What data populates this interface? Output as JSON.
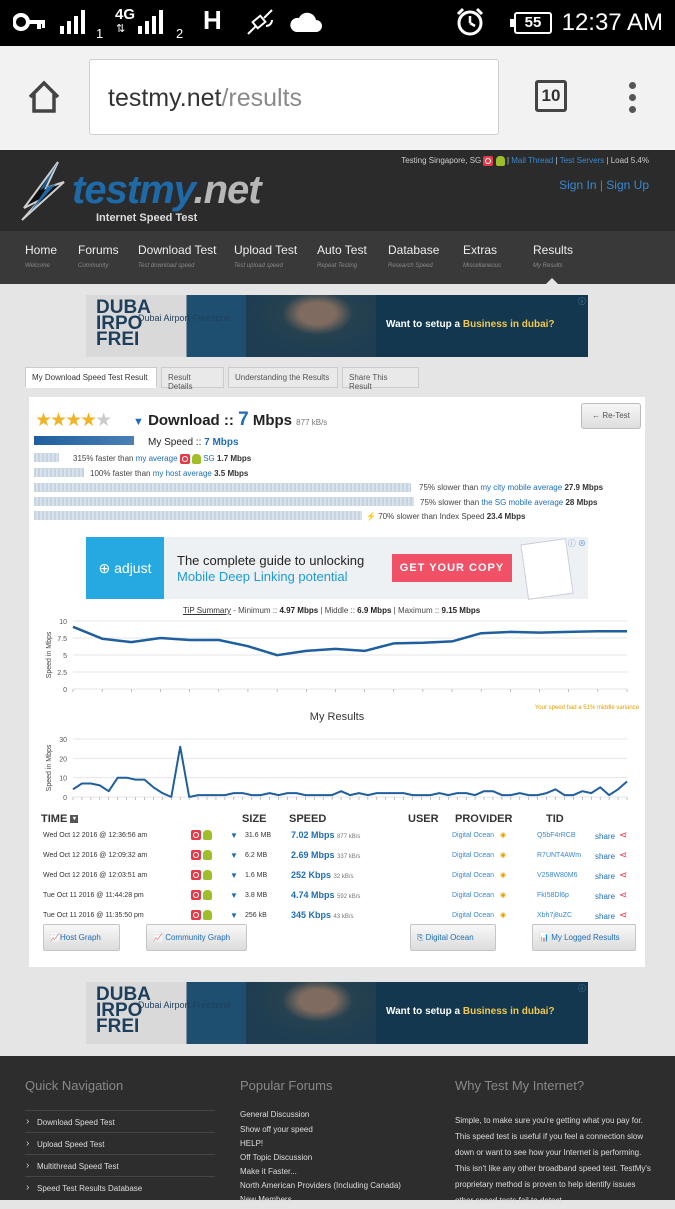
{
  "status_bar": {
    "sim1": "1",
    "net": "4G",
    "sim2": "2",
    "battery": "55",
    "time": "12:37 AM"
  },
  "browser": {
    "url_host": "testmy.net",
    "url_path": "/results",
    "tab_count": "10"
  },
  "site": {
    "logo_main": "testmy",
    "logo_tld": ".net",
    "logo_sub": "Internet Speed Test",
    "top_info_prefix": "Testing Singapore, SG",
    "top_info_links": [
      "Mail Thread",
      "Test Servers"
    ],
    "top_info_load": "Load 5.4%",
    "sign_in": "Sign In",
    "sign_up": "Sign Up"
  },
  "nav": [
    {
      "label": "Home",
      "sub": "Welcome"
    },
    {
      "label": "Forums",
      "sub": "Community"
    },
    {
      "label": "Download Test",
      "sub": "Test download speed"
    },
    {
      "label": "Upload Test",
      "sub": "Test upload speed"
    },
    {
      "label": "Auto Test",
      "sub": "Repeat Testing"
    },
    {
      "label": "Database",
      "sub": "Research Speed"
    },
    {
      "label": "Extras",
      "sub": "Miscellaneous"
    },
    {
      "label": "Results",
      "sub": "My Results"
    }
  ],
  "ad_top": {
    "brand_lines": "DUBA IRPO FREI",
    "brand_name": "Dubai Airport Freezone",
    "msg_pre": "Want to setup a",
    "msg_hl": "Business in dubai?",
    "close": "ⓘ"
  },
  "subtabs": [
    "My Download Speed Test Result",
    "Result Details",
    "Understanding the Results",
    "Share This Result"
  ],
  "result": {
    "rating": 4,
    "title": "Download",
    "sep": "::",
    "value": "7",
    "unit": "Mbps",
    "kb": "877 kB/s",
    "retest": "← Re-Test",
    "my_speed_label": "My Speed ::",
    "my_speed_value": "7 Mbps",
    "comparisons_left": [
      {
        "pre": "315% faster than",
        "link": "my average",
        "after": "SG",
        "value": "1.7 Mbps",
        "fraction": 0.245
      },
      {
        "pre": "100% faster than",
        "link": "my host average",
        "after": "",
        "value": "3.5 Mbps",
        "fraction": 0.125
      }
    ],
    "comparisons_right": [
      {
        "pre": "75% slower than",
        "link": "my city mobile average",
        "value": "27.9 Mbps",
        "fraction": 0.995
      },
      {
        "pre": "75% slower than",
        "link": "the SG mobile average",
        "value": "28 Mbps",
        "fraction": 0.999
      },
      {
        "pre": "70% slower than Index Speed",
        "link": "",
        "value": "23.4 Mbps",
        "fraction": 0.835
      }
    ]
  },
  "ad_mid": {
    "brand": "adjust",
    "line1": "The complete guide to unlocking",
    "line2": "Mobile Deep Linking potential",
    "cta": "GET YOUR COPY"
  },
  "tip": {
    "label": "TiP Summary",
    "min_label": "Minimum ::",
    "min": "4.97 Mbps",
    "mid_label": "Middle ::",
    "mid": "6.9 Mbps",
    "max_label": "Maximum ::",
    "max": "9.15 Mbps",
    "variance": "Your speed had a 51% middle variance"
  },
  "chart_data": [
    {
      "type": "line",
      "title": "",
      "ylabel": "Speed in Mbps",
      "ylim": [
        0,
        10
      ],
      "yticks": [
        0,
        2.5,
        5,
        7.5,
        10
      ],
      "series": [
        {
          "values": [
            9.15,
            7.4,
            6.9,
            7.5,
            7.2,
            7.2,
            6.3,
            4.97,
            5.6,
            5.9,
            5.6,
            6.7,
            6.8,
            7.0,
            8.2,
            8.4,
            8.3,
            8.4,
            8.5,
            8.5
          ]
        }
      ]
    },
    {
      "type": "line",
      "title": "My Results",
      "ylabel": "Speed in Mbps",
      "ylim": [
        0,
        30
      ],
      "yticks": [
        0,
        10,
        20,
        30
      ],
      "series": [
        {
          "values": [
            4,
            7,
            7,
            6,
            3,
            10,
            10,
            9,
            9,
            5,
            2,
            0,
            26,
            0,
            1,
            1,
            1,
            1,
            2,
            2,
            1,
            1,
            2,
            1,
            2,
            2,
            1,
            1,
            1,
            1,
            3,
            1,
            2,
            1,
            2,
            2,
            2,
            2,
            1,
            1,
            1,
            2,
            1,
            2,
            2,
            1,
            3,
            3,
            1,
            1,
            2,
            1,
            1,
            2,
            4,
            1,
            1,
            3,
            2,
            5,
            1,
            4,
            8
          ]
        }
      ]
    }
  ],
  "table": {
    "headers": {
      "time": "TIME",
      "size": "SIZE",
      "speed": "SPEED",
      "user": "USER",
      "provider": "PROVIDER",
      "tid": "TID"
    },
    "rows": [
      {
        "time": "Wed Oct 12 2016 @ 12:36:56 am",
        "size": "31.6 MB",
        "speed": "7.02 Mbps",
        "kb": "877 kB/s",
        "provider": "Digital Ocean",
        "tid": "Q5bF4rRCB",
        "share": "share"
      },
      {
        "time": "Wed Oct 12 2016 @ 12:09:32 am",
        "size": "6.2 MB",
        "speed": "2.69 Mbps",
        "kb": "337 kB/s",
        "provider": "Digital Ocean",
        "tid": "R7UNT4AWm",
        "share": "share"
      },
      {
        "time": "Wed Oct 12 2016 @ 12:03:51 am",
        "size": "1.6 MB",
        "speed": "252 Kbps",
        "kb": "32 kB/s",
        "provider": "Digital Ocean",
        "tid": "V258W80M6",
        "share": "share"
      },
      {
        "time": "Tue Oct 11 2016 @ 11:44:28 pm",
        "size": "3.8 MB",
        "speed": "4.74 Mbps",
        "kb": "592 kB/s",
        "provider": "Digital Ocean",
        "tid": "FkI58Dl6p",
        "share": "share"
      },
      {
        "time": "Tue Oct 11 2016 @ 11:35:50 pm",
        "size": "256 kB",
        "speed": "345 Kbps",
        "kb": "43 kB/s",
        "provider": "Digital Ocean",
        "tid": "Xbh7j8uZC",
        "share": "share"
      }
    ]
  },
  "buttons": {
    "host_graph": "Host Graph",
    "community_graph": "Community Graph",
    "digital_ocean": "Digital Ocean",
    "my_logged": "My Logged Results"
  },
  "footer": {
    "quick_nav_title": "Quick Navigation",
    "quick_nav": [
      "Download Speed Test",
      "Upload Speed Test",
      "Multithread Speed Test",
      "Speed Test Results Database"
    ],
    "forums_title": "Popular Forums",
    "forums": [
      "General Discussion",
      "Show off your speed",
      "HELP!",
      "Off Topic Discussion",
      "Make it Faster...",
      "North American Providers (Including Canada)",
      "New Members"
    ],
    "why_title": "Why Test My Internet?",
    "why_text": "Simple, to make sure you're getting what you pay for. This speed test is useful if you feel a connection slow down or want to see how your Internet is performing. This isn't like any other broadband speed test. TestMy's proprietary method is proven to help identify issues other speed tests fail to detect."
  }
}
